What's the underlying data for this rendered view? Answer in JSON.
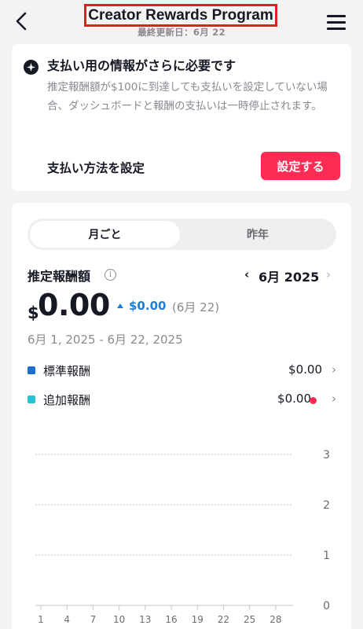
{
  "header": {
    "title": "Creator Rewards Program",
    "last_updated": "最終更新日：6月 22"
  },
  "notice": {
    "title": "支払い用の情報がさらに必要です",
    "body": "推定報酬額が$100に到達しても支払いを設定していない場合、ダッシュボードと報酬の支払いは一時停止されます。",
    "payment_label": "支払い方法を設定",
    "setup_button": "設定する"
  },
  "period_tabs": [
    "月ごと",
    "昨年"
  ],
  "estimate": {
    "label": "推定報酬額",
    "info_symbol": "i",
    "month": "6月 2025",
    "currency": "$",
    "amount": "0.00",
    "delta": "$0.00",
    "delta_date": "(6月 22)",
    "date_range": "6月 1, 2025 - 6月 22, 2025"
  },
  "legend": [
    {
      "name": "標準報酬",
      "value": "$0.00",
      "color": "#1a6fd1"
    },
    {
      "name": "追加報酬",
      "value": "$0.00",
      "color": "#27c3d6",
      "alert": true
    }
  ],
  "colors": {
    "accent": "#fe2c55",
    "delta": "#1e7fd2"
  },
  "chart_data": {
    "type": "bar",
    "categories": [
      "1",
      "4",
      "7",
      "10",
      "13",
      "16",
      "19",
      "22",
      "25",
      "28"
    ],
    "series": [
      {
        "values": [
          0,
          0,
          0,
          0,
          0,
          0,
          0,
          0,
          0,
          0
        ]
      },
      {
        "values": [
          0,
          0,
          0,
          0,
          0,
          0,
          0,
          0,
          0,
          0
        ]
      }
    ],
    "yticks": [
      0,
      1,
      2,
      3
    ],
    "ylim": [
      0,
      3
    ],
    "grid": true
  }
}
